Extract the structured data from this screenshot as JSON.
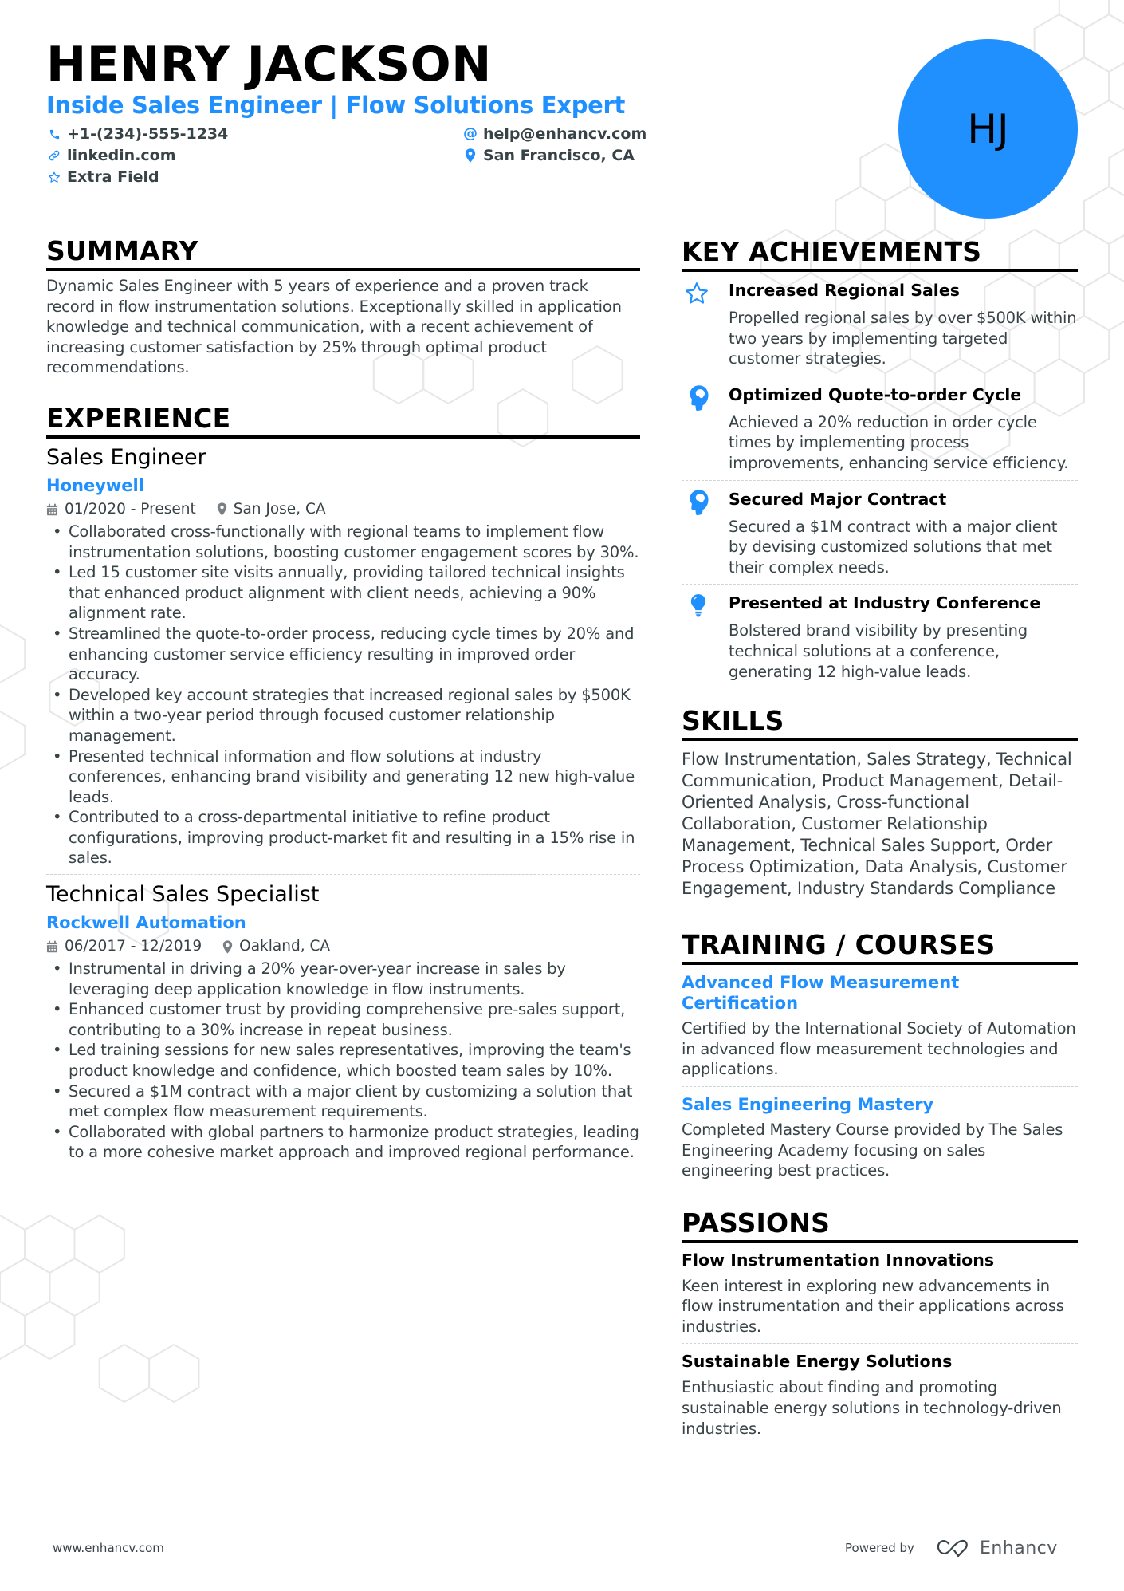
{
  "header": {
    "name": "HENRY JACKSON",
    "title": "Inside Sales Engineer | Flow Solutions Expert",
    "initials": "HJ",
    "accent_color": "#2190ff",
    "contacts": [
      {
        "icon": "phone-icon",
        "text": "+1-(234)-555-1234"
      },
      {
        "icon": "link-icon",
        "text": "linkedin.com"
      },
      {
        "icon": "star-icon",
        "text": "Extra Field"
      },
      {
        "icon": "at-icon",
        "text": "help@enhancv.com"
      },
      {
        "icon": "location-pin-icon",
        "text": "San Francisco, CA"
      }
    ]
  },
  "summary": {
    "heading": "SUMMARY",
    "text": "Dynamic Sales Engineer with 5 years of experience and a proven track record in flow instrumentation solutions. Exceptionally skilled in application knowledge and technical communication, with a recent achievement of increasing customer satisfaction by 25% through optimal product recommendations."
  },
  "experience": {
    "heading": "EXPERIENCE",
    "jobs": [
      {
        "title": "Sales Engineer",
        "company": "Honeywell",
        "dates": "01/2020 - Present",
        "location": "San Jose, CA",
        "bullets": [
          "Collaborated cross-functionally with regional teams to implement flow instrumentation solutions, boosting customer engagement scores by 30%.",
          "Led 15 customer site visits annually, providing tailored technical insights that enhanced product alignment with client needs, achieving a 90% alignment rate.",
          "Streamlined the quote-to-order process, reducing cycle times by 20% and enhancing customer service efficiency resulting in improved order accuracy.",
          "Developed key account strategies that increased regional sales by $500K within a two-year period through focused customer relationship management.",
          "Presented technical information and flow solutions at industry conferences, enhancing brand visibility and generating 12 new high-value leads.",
          "Contributed to a cross-departmental initiative to refine product configurations, improving product-market fit and resulting in a 15% rise in sales."
        ]
      },
      {
        "title": "Technical Sales Specialist",
        "company": "Rockwell Automation",
        "dates": "06/2017 - 12/2019",
        "location": "Oakland, CA",
        "bullets": [
          "Instrumental in driving a 20% year-over-year increase in sales by leveraging deep application knowledge in flow instruments.",
          "Enhanced customer trust by providing comprehensive pre-sales support, contributing to a 30% increase in repeat business.",
          "Led training sessions for new sales representatives, improving the team's product knowledge and confidence, which boosted team sales by 10%.",
          "Secured a $1M contract with a major client by customizing a solution that met complex flow measurement requirements.",
          "Collaborated with global partners to harmonize product strategies, leading to a more cohesive market approach and improved regional performance."
        ]
      }
    ]
  },
  "achievements": {
    "heading": "KEY ACHIEVEMENTS",
    "items": [
      {
        "icon": "star-outline-icon",
        "title": "Increased Regional Sales",
        "text": "Propelled regional sales by over $500K within two years by implementing targeted customer strategies."
      },
      {
        "icon": "head-brain-icon",
        "title": "Optimized Quote-to-order Cycle",
        "text": "Achieved a 20% reduction in order cycle times by implementing process improvements, enhancing service efficiency."
      },
      {
        "icon": "head-brain-icon",
        "title": "Secured Major Contract",
        "text": "Secured a $1M contract with a major client by devising customized solutions that met their complex needs."
      },
      {
        "icon": "lightbulb-icon",
        "title": "Presented at Industry Conference",
        "text": "Bolstered brand visibility by presenting technical solutions at a conference, generating 12 high-value leads."
      }
    ]
  },
  "skills": {
    "heading": "SKILLS",
    "text": "Flow Instrumentation, Sales Strategy, Technical Communication, Product Management, Detail-Oriented Analysis, Cross-functional Collaboration, Customer Relationship Management, Technical Sales Support, Order Process Optimization, Data Analysis, Customer Engagement, Industry Standards Compliance"
  },
  "training": {
    "heading": "TRAINING / COURSES",
    "items": [
      {
        "title": "Advanced Flow Measurement Certification",
        "text": "Certified by the International Society of Automation in advanced flow measurement technologies and applications."
      },
      {
        "title": "Sales Engineering Mastery",
        "text": "Completed Mastery Course provided by The Sales Engineering Academy focusing on sales engineering best practices."
      }
    ]
  },
  "passions": {
    "heading": "PASSIONS",
    "items": [
      {
        "title": "Flow Instrumentation Innovations",
        "text": "Keen interest in exploring new advancements in flow instrumentation and their applications across industries."
      },
      {
        "title": "Sustainable Energy Solutions",
        "text": "Enthusiastic about finding and promoting sustainable energy solutions in technology-driven industries."
      }
    ]
  },
  "footer": {
    "website": "www.enhancv.com",
    "powered_by": "Powered by",
    "brand": "Enhancv"
  }
}
